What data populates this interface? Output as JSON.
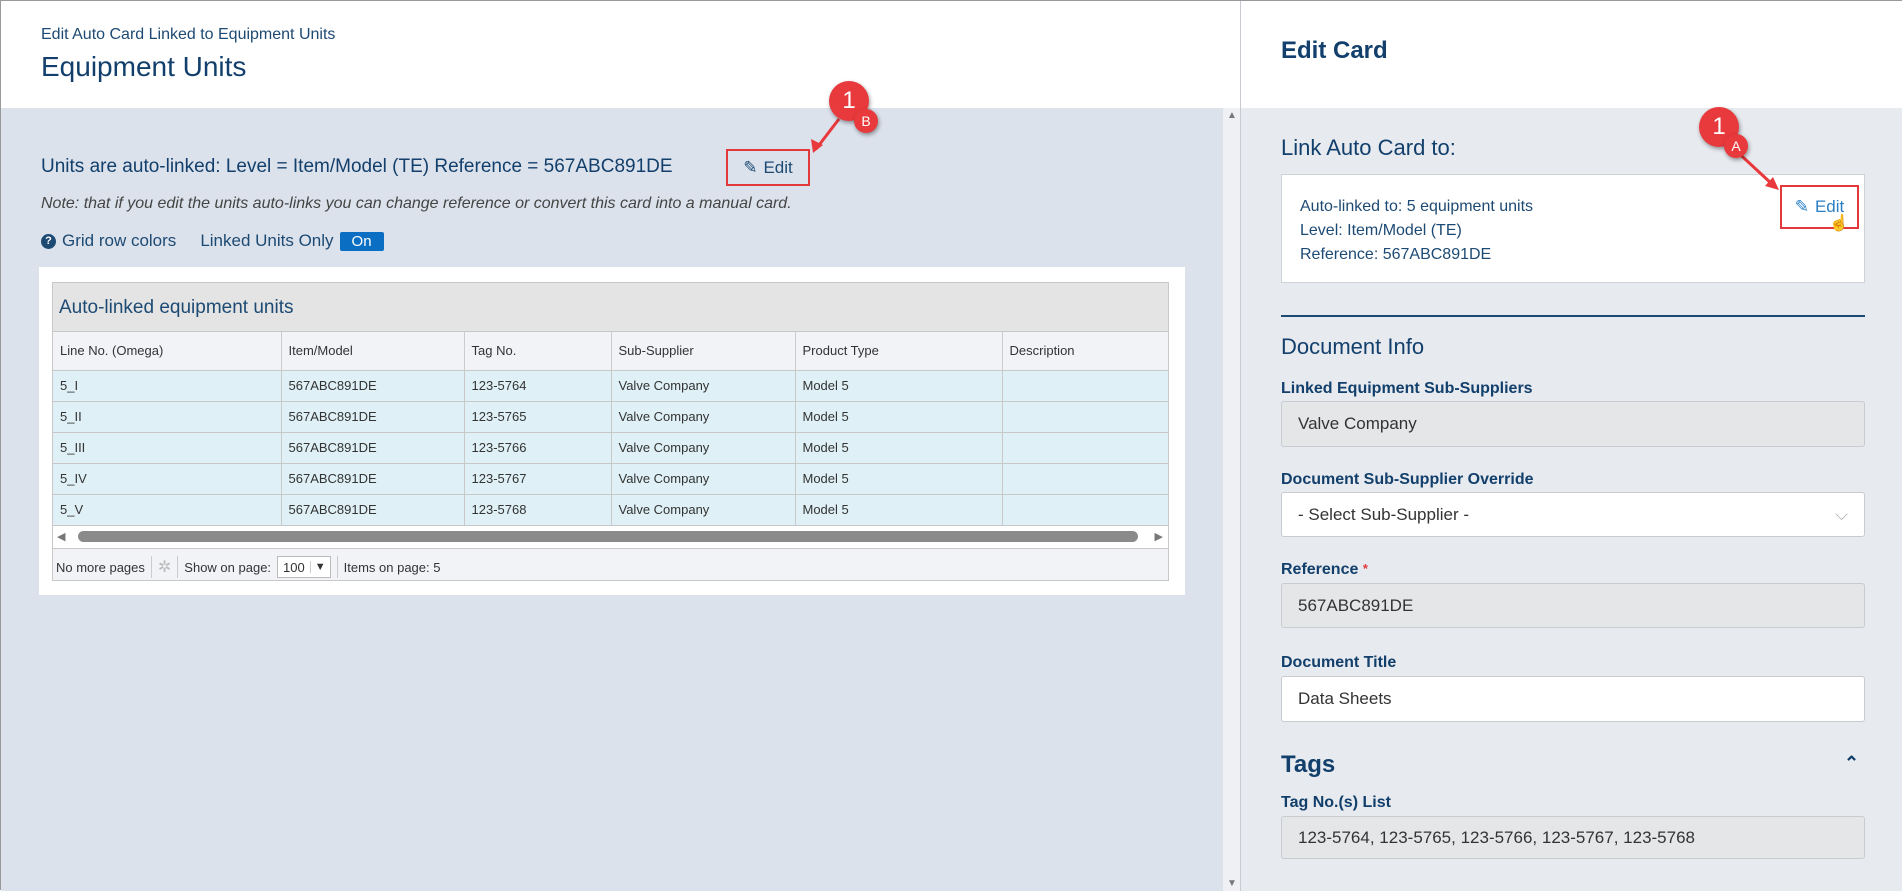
{
  "left": {
    "breadcrumb": "Edit Auto Card Linked to Equipment Units",
    "title": "Equipment Units",
    "autolink_text": "Units are auto-linked: Level = Item/Model (TE) Reference = 567ABC891DE",
    "edit_label": "Edit",
    "note": "Note: that if you edit the units auto-links you can change reference or convert this card into a manual card.",
    "grid_row_colors": "Grid row colors",
    "linked_units_only": "Linked Units Only",
    "toggle": "On",
    "grid": {
      "caption": "Auto-linked equipment units",
      "columns": [
        "Line No. (Omega)",
        "Item/Model",
        "Tag No.",
        "Sub-Supplier",
        "Product Type",
        "Description"
      ],
      "rows": [
        [
          "5_I",
          "567ABC891DE",
          "123-5764",
          "Valve Company",
          "Model 5",
          ""
        ],
        [
          "5_II",
          "567ABC891DE",
          "123-5765",
          "Valve Company",
          "Model 5",
          ""
        ],
        [
          "5_III",
          "567ABC891DE",
          "123-5766",
          "Valve Company",
          "Model 5",
          ""
        ],
        [
          "5_IV",
          "567ABC891DE",
          "123-5767",
          "Valve Company",
          "Model 5",
          ""
        ],
        [
          "5_V",
          "567ABC891DE",
          "123-5768",
          "Valve Company",
          "Model 5",
          ""
        ]
      ],
      "no_more_pages": "No more pages",
      "show_on_page": "Show on page:",
      "page_size": "100",
      "items_on_page": "Items on page: 5"
    }
  },
  "right": {
    "title": "Edit Card",
    "link_heading": "Link Auto Card to:",
    "link_lines": [
      "Auto-linked to: 5 equipment units",
      "Level: Item/Model (TE)",
      "Reference: 567ABC891DE"
    ],
    "edit_label": "Edit",
    "doc_info": "Document Info",
    "linked_subsuppliers_label": "Linked Equipment Sub-Suppliers",
    "linked_subsuppliers_value": "Valve Company",
    "override_label": "Document Sub-Supplier Override",
    "override_value": "- Select Sub-Supplier -",
    "reference_label": "Reference",
    "required_mark": "*",
    "reference_value": "567ABC891DE",
    "doc_title_label": "Document Title",
    "doc_title_value": "Data Sheets",
    "tags_heading": "Tags",
    "tag_list_label": "Tag No.(s) List",
    "tag_list_value": "123-5764, 123-5765, 123-5766, 123-5767, 123-5768"
  },
  "annotations": {
    "a_num": "1",
    "a_letter": "A",
    "b_num": "1",
    "b_letter": "B",
    "color": "#e8393c"
  }
}
